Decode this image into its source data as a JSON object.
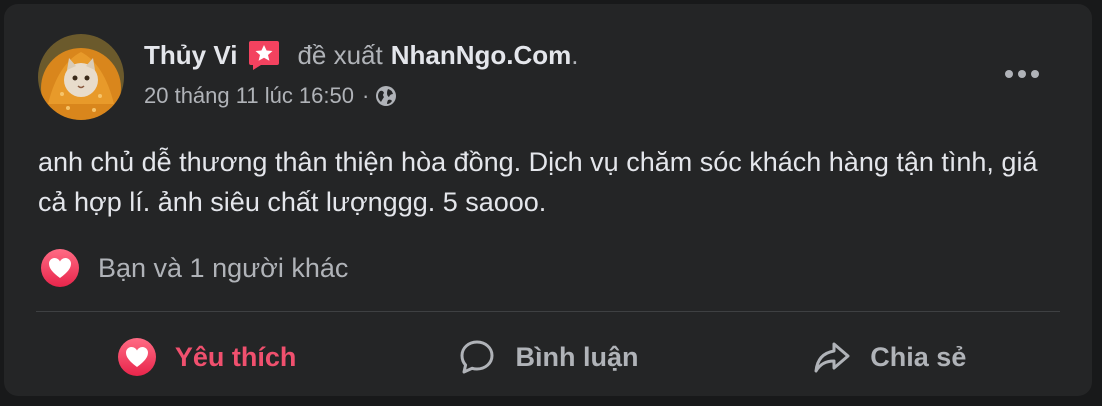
{
  "post": {
    "author": "Thủy Vi",
    "recommends_text": "đề xuất",
    "page_name": "NhanNgo.Com",
    "period": ".",
    "timestamp": "20 tháng 11 lúc 16:50",
    "separator": "·",
    "privacy_icon": "globe-icon",
    "badge_icon": "star-badge-icon",
    "more_icon": "more-options-icon",
    "text": "anh chủ dễ thương thân thiện hòa đồng. Dịch vụ chăm sóc khách hàng tận tình, giá cả hợp lí. ảnh siêu chất lượnggg. 5 saooo."
  },
  "reactions": {
    "icon": "love-reaction-icon",
    "summary": "Bạn và 1 người khác"
  },
  "actions": {
    "like": {
      "label": "Yêu thích",
      "icon": "heart-icon",
      "active": true
    },
    "comment": {
      "label": "Bình luận",
      "icon": "comment-icon"
    },
    "share": {
      "label": "Chia sẻ",
      "icon": "share-icon"
    }
  },
  "colors": {
    "background": "#18191a",
    "card": "#242526",
    "text_primary": "#e4e6eb",
    "text_secondary": "#b0b3b8",
    "liked": "#f0506e",
    "badge": "#f3425f"
  }
}
